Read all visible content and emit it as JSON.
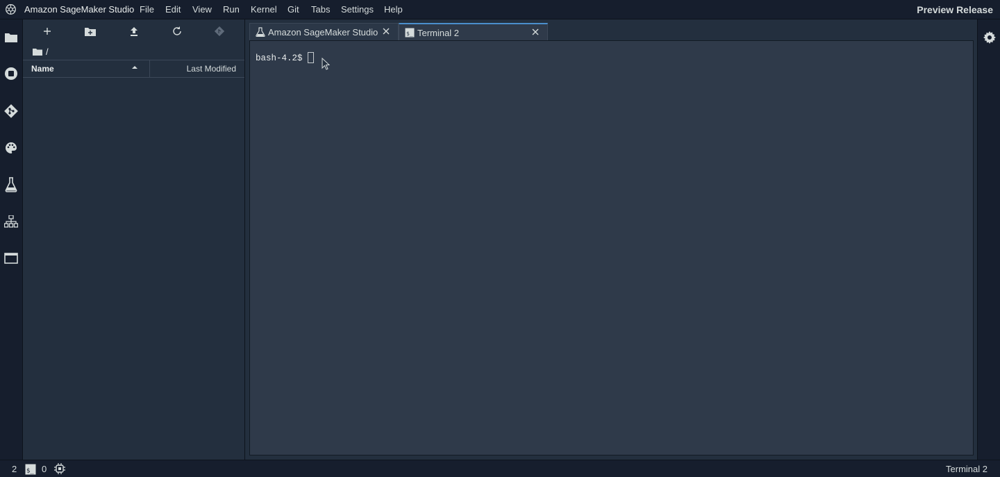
{
  "menubar": {
    "app_title": "Amazon SageMaker Studio",
    "items": [
      "File",
      "Edit",
      "View",
      "Run",
      "Kernel",
      "Git",
      "Tabs",
      "Settings",
      "Help"
    ],
    "preview_label": "Preview Release"
  },
  "left_bar": {
    "icons": [
      "folder-icon",
      "running-stop-icon",
      "git-icon",
      "palette-icon",
      "flask-icon",
      "network-icon",
      "window-icon"
    ]
  },
  "file_browser": {
    "toolbar_icons": [
      "new-launcher-icon",
      "new-folder-icon",
      "upload-icon",
      "refresh-icon",
      "git-clone-icon"
    ],
    "path": "/",
    "columns": {
      "name": "Name",
      "last_modified": "Last Modified"
    },
    "rows": []
  },
  "tabs": [
    {
      "label": "Amazon SageMaker Studio",
      "icon": "flask-icon",
      "active": false
    },
    {
      "label": "Terminal 2",
      "icon": "terminal-icon",
      "active": true
    }
  ],
  "terminal": {
    "prompt": "bash-4.2$"
  },
  "statusbar": {
    "terminals_count": "2",
    "kernels_count": "0",
    "active_label": "Terminal 2"
  },
  "colors": {
    "background": "#232f3e",
    "bars": "#161e2d",
    "terminal_bg": "#2f3a4a",
    "accent": "#4b8fcd"
  }
}
